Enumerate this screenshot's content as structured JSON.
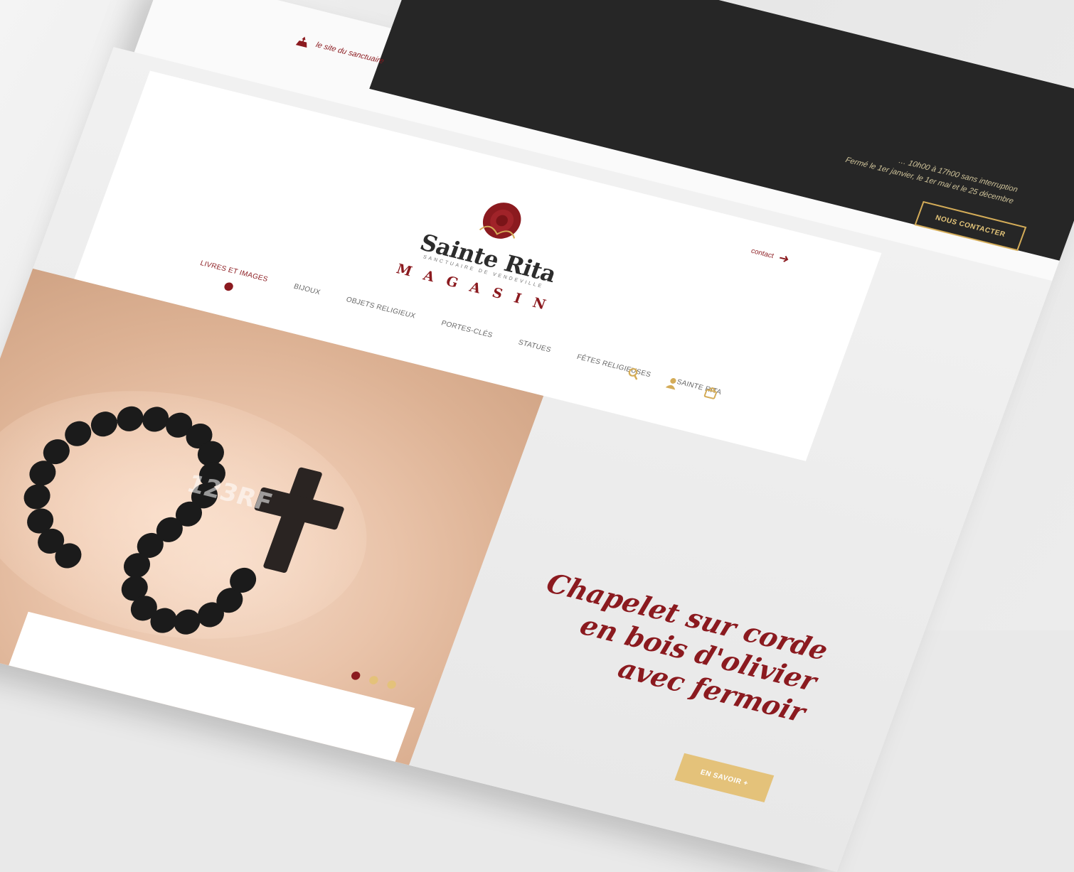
{
  "contact_band": {
    "text_lines": [
      "… 10h00 à 17h00 sans interruption",
      "Fermé le 1er janvier, le 1er mai et le 25 décembre"
    ],
    "button_label": "NOUS CONTACTER"
  },
  "topbar": {
    "site_link": "le site du sanctuaire"
  },
  "header": {
    "logo_title": "Sainte Rita",
    "logo_subtitle": "SANCTUAIRE DE VENDEVILLE",
    "magasin": "MAGASIN",
    "contact_link": "contact",
    "nav": [
      {
        "label": "LIVRES ET IMAGES",
        "active": true
      },
      {
        "label": "BIJOUX",
        "active": false
      },
      {
        "label": "OBJETS RELIGIEUX",
        "active": false
      },
      {
        "label": "PORTES-CLÉS",
        "active": false
      },
      {
        "label": "STATUES",
        "active": false
      },
      {
        "label": "FÊTES RELIGIEUSES",
        "active": false
      },
      {
        "label": "SAINTE RITA",
        "active": false
      }
    ]
  },
  "hero": {
    "headline_lines": [
      "Chapelet sur corde",
      "en bois d'olivier",
      "avec fermoir"
    ],
    "cta_label": "EN SAVOIR +",
    "watermark": "123RF",
    "slider_active": 1,
    "slider_count": 3
  },
  "colors": {
    "brand_red": "#8b1a1f",
    "gold": "#e4c27a",
    "dark_band": "#262626"
  }
}
